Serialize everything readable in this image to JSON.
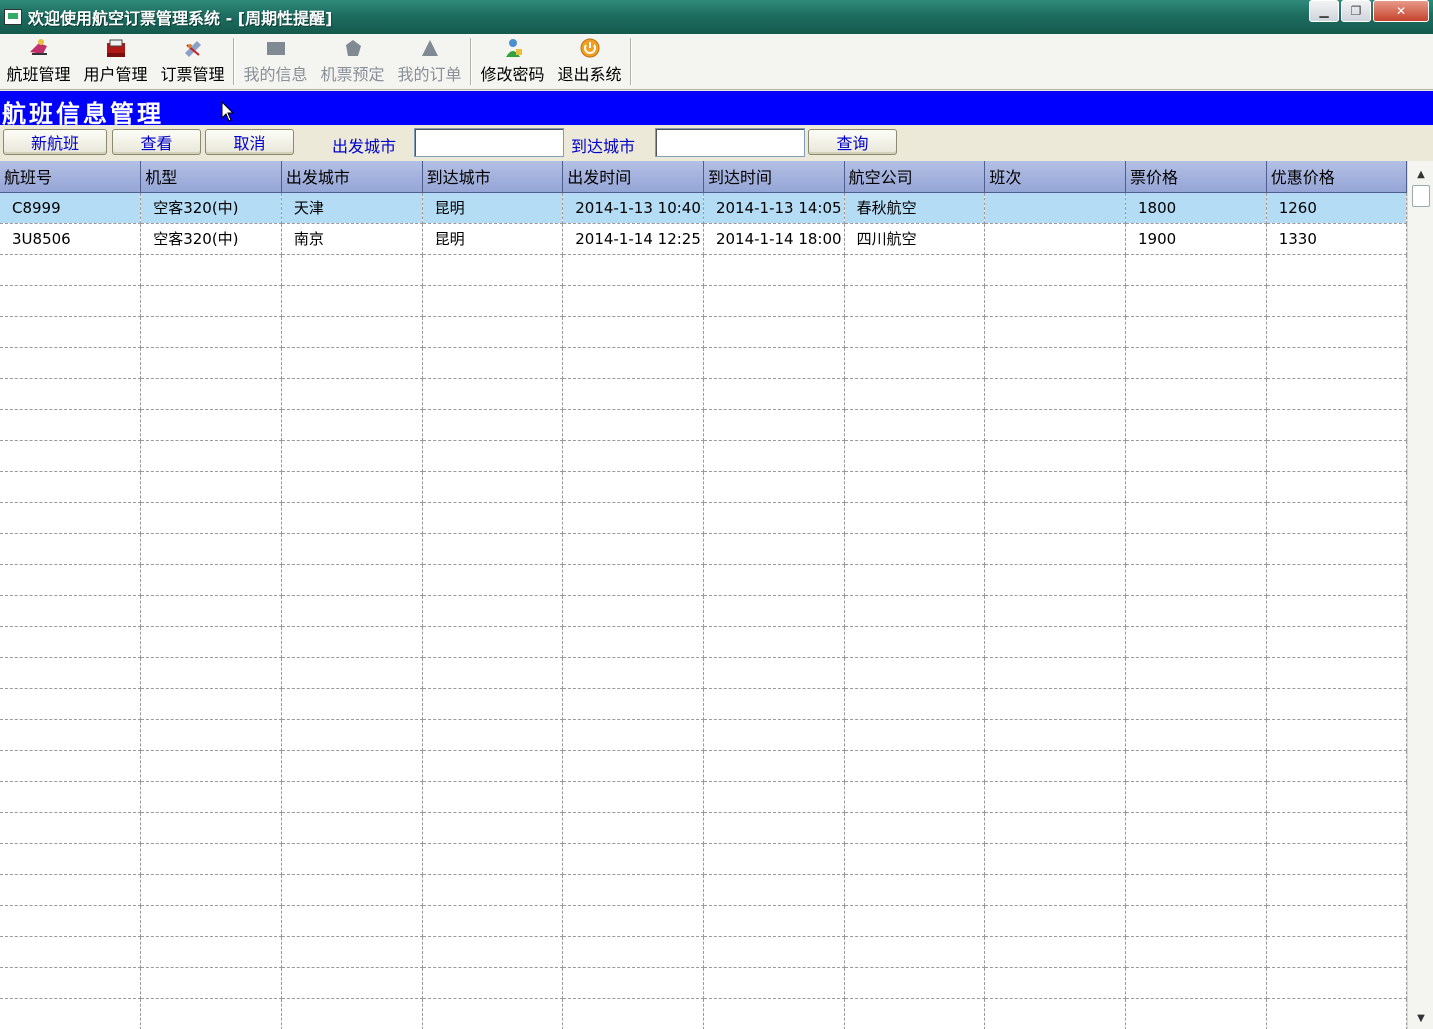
{
  "window": {
    "title": "欢迎使用航空订票管理系统 - [周期性提醒]",
    "minimize_icon": "minimize-icon",
    "restore_icon": "restore-icon",
    "close_icon": "close-icon",
    "close_symbol": "✕"
  },
  "toolbar": {
    "items": [
      {
        "label": "航班管理",
        "icon": "flight-icon",
        "enabled": true
      },
      {
        "label": "用户管理",
        "icon": "user-book-icon",
        "enabled": true
      },
      {
        "label": "订票管理",
        "icon": "ticket-icon",
        "enabled": true
      },
      {
        "label": "我的信息",
        "icon": "info-icon",
        "enabled": false
      },
      {
        "label": "机票预定",
        "icon": "booking-icon",
        "enabled": false
      },
      {
        "label": "我的订单",
        "icon": "order-icon",
        "enabled": false
      },
      {
        "label": "修改密码",
        "icon": "password-user-icon",
        "enabled": true
      },
      {
        "label": "退出系统",
        "icon": "exit-icon",
        "enabled": true
      }
    ]
  },
  "section": {
    "title": "航班信息管理"
  },
  "search": {
    "new_label": "新航班",
    "view_label": "查看",
    "cancel_label": "取消",
    "from_label": "出发城市",
    "from_value": "",
    "to_label": "到达城市",
    "to_value": "",
    "query_label": "查询"
  },
  "table": {
    "columns": [
      "航班号",
      "机型",
      "出发城市",
      "到达城市",
      "出发时间",
      "到达时间",
      "航空公司",
      "班次",
      "票价格",
      "优惠价格"
    ],
    "rows": [
      [
        "C8999",
        "空客320(中)",
        "天津",
        "昆明",
        "2014-1-13 10:40",
        "2014-1-13 14:05",
        "春秋航空",
        "",
        "1800",
        "1260"
      ],
      [
        "3U8506",
        "空客320(中)",
        "南京",
        "昆明",
        "2014-1-14 12:25",
        "2014-1-14 18:00",
        "四川航空",
        "",
        "1900",
        "1330"
      ]
    ],
    "selected_row": 0
  },
  "colors": {
    "header_bar": "#0000ff",
    "selected_row": "#b5dcf5",
    "title_bar": "#1d6e60"
  }
}
